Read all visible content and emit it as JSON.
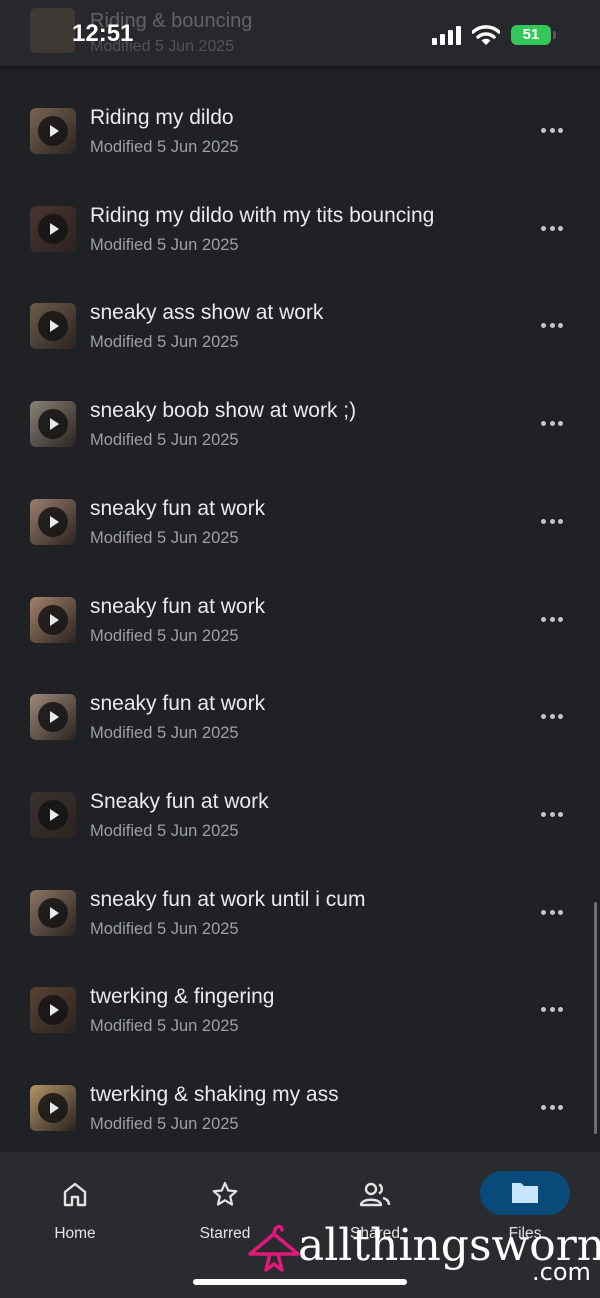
{
  "status_bar": {
    "time": "12:51",
    "battery": "51",
    "partial_row": {
      "title": "Riding & bouncing",
      "subtitle": "Modified 5 Jun 2025"
    }
  },
  "files": [
    {
      "title": "Riding my dildo",
      "modified": "Modified 5 Jun 2025",
      "thumb_color": "#7a6552"
    },
    {
      "title": "Riding my dildo with my tits bouncing",
      "modified": "Modified 5 Jun 2025",
      "thumb_color": "#4a3430"
    },
    {
      "title": "sneaky ass show at work",
      "modified": "Modified 5 Jun 2025",
      "thumb_color": "#6e5c4c"
    },
    {
      "title": "sneaky boob show at work ;)",
      "modified": "Modified 5 Jun 2025",
      "thumb_color": "#8a8278"
    },
    {
      "title": "sneaky fun at work",
      "modified": "Modified 5 Jun 2025",
      "thumb_color": "#9a7f6c"
    },
    {
      "title": "sneaky fun at work",
      "modified": "Modified 5 Jun 2025",
      "thumb_color": "#a3826a"
    },
    {
      "title": "sneaky fun at work",
      "modified": "Modified 5 Jun 2025",
      "thumb_color": "#9e8a7a"
    },
    {
      "title": "Sneaky fun at work",
      "modified": "Modified 5 Jun 2025",
      "thumb_color": "#3a3230"
    },
    {
      "title": "sneaky fun at work until i cum",
      "modified": "Modified 5 Jun 2025",
      "thumb_color": "#8c7464"
    },
    {
      "title": "twerking & fingering",
      "modified": "Modified 5 Jun 2025",
      "thumb_color": "#5a4234"
    },
    {
      "title": "twerking & shaking my ass",
      "modified": "Modified 5 Jun 2025",
      "thumb_color": "#b39468"
    }
  ],
  "nav": {
    "home": "Home",
    "starred": "Starred",
    "shared": "Shared",
    "files": "Files",
    "active": "files",
    "active_color": "#0a4a7a"
  },
  "watermark": {
    "brand": "allthingsworn",
    "suffix": ".com",
    "color": "#e0197b"
  },
  "icons": [
    "play-icon",
    "more-icon",
    "home-icon",
    "star-icon",
    "people-icon",
    "folder-icon"
  ]
}
